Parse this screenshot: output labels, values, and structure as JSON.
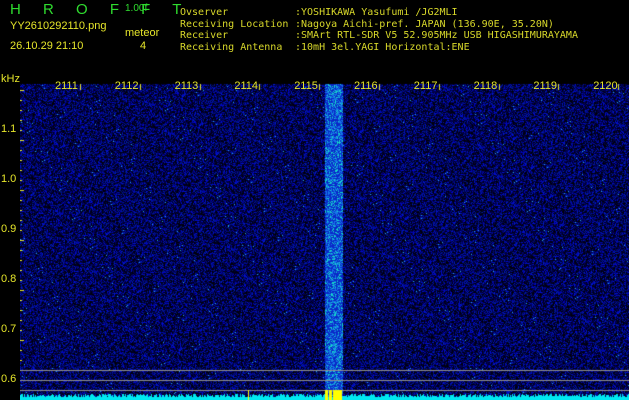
{
  "header": {
    "app_title": "H R O F F T",
    "version": "1.00f",
    "filename": "YY2610292110.png",
    "datetime": "26.10.29 21:10",
    "meteor_label": "meteor",
    "meteor_count": "4",
    "info": [
      {
        "label": "Ovserver",
        "value": ":YOSHIKAWA Yasufumi /JG2MLI"
      },
      {
        "label": "Receiving Location",
        "value": ":Nagoya Aichi-pref. JAPAN (136.90E, 35.20N)"
      },
      {
        "label": "Receiver",
        "value": ":SMArt RTL-SDR V5 52.905MHz USB HIGASHIMURAYAMA"
      },
      {
        "label": "Receiving Antenna",
        "value": ":10mH 3el.YAGI Horizontal:ENE"
      }
    ]
  },
  "axes": {
    "y_unit": "kHz",
    "y_ticks": [
      "1.1",
      "1.0",
      "0.9",
      "0.8",
      "0.7",
      "0.6"
    ],
    "x_ticks": [
      "2111",
      "2112",
      "2113",
      "2114",
      "2115",
      "2116",
      "2117",
      "2118",
      "2119",
      "2120"
    ]
  },
  "colors": {
    "text_yellow": "#e6e62a",
    "title_green": "#2fdc2f",
    "spectrum_cyan": "#00e8f0",
    "noise_blue": "#1020c0"
  }
}
